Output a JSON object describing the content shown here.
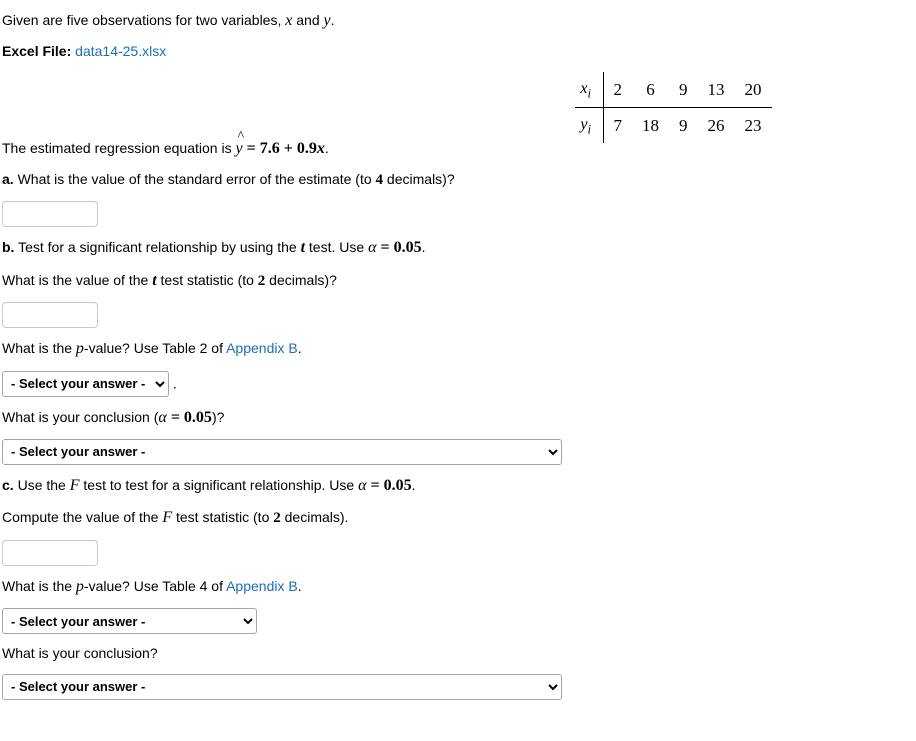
{
  "intro": {
    "line1_a": "Given are five observations for two variables, ",
    "var_x": "x",
    "line1_b": " and ",
    "var_y": "y",
    "line1_c": ".",
    "excel_label": "Excel File: ",
    "excel_link": "data14-25.xlsx"
  },
  "table": {
    "x_label": "x",
    "y_label": "y",
    "sub_i": "i",
    "x": [
      "2",
      "6",
      "9",
      "13",
      "20"
    ],
    "y": [
      "7",
      "18",
      "9",
      "26",
      "23"
    ]
  },
  "regression": {
    "pre": "The estimated regression equation is ",
    "yhat": "y",
    "eq_mid": " = 7.6 + 0.9",
    "eq_x": "x",
    "eq_end": "."
  },
  "a": {
    "label": "a.",
    "text_a": " What is the value of the standard error of the estimate (to ",
    "four": "4",
    "text_b": " decimals)?"
  },
  "b": {
    "label": "b.",
    "text_a": " Test for a significant relationship by using the ",
    "t_sym": "t",
    "text_b": " test. Use ",
    "alpha_sym": "α",
    "text_c": " = 0.05",
    "period": "."
  },
  "b_q1": {
    "a": "What is the value of the ",
    "t": "t",
    "b": " test statistic (to ",
    "two": "2",
    "c": " decimals)?"
  },
  "b_q2": {
    "a": "What is the ",
    "p": "p",
    "b": "-value? Use Table 2 of ",
    "link": "Appendix B",
    "c": "."
  },
  "b_q3": {
    "a": "What is your conclusion (",
    "alpha": "α",
    "b": " = 0.05",
    "c": ")?"
  },
  "c": {
    "label": "c.",
    "text_a": " Use the ",
    "F": "F",
    "text_b": " test to test for a significant relationship. Use ",
    "alpha": "α",
    "text_c": " = 0.05",
    "period": "."
  },
  "c_q1": {
    "a": "Compute the value of the ",
    "F": "F",
    "b": " test statistic (to ",
    "two": "2",
    "c": " decimals)."
  },
  "c_q2": {
    "a": "What is the ",
    "p": "p",
    "b": "-value? Use Table 4 of ",
    "link": "Appendix B",
    "c": "."
  },
  "c_q3": "What is your conclusion?",
  "select_placeholder": "- Select your answer -"
}
